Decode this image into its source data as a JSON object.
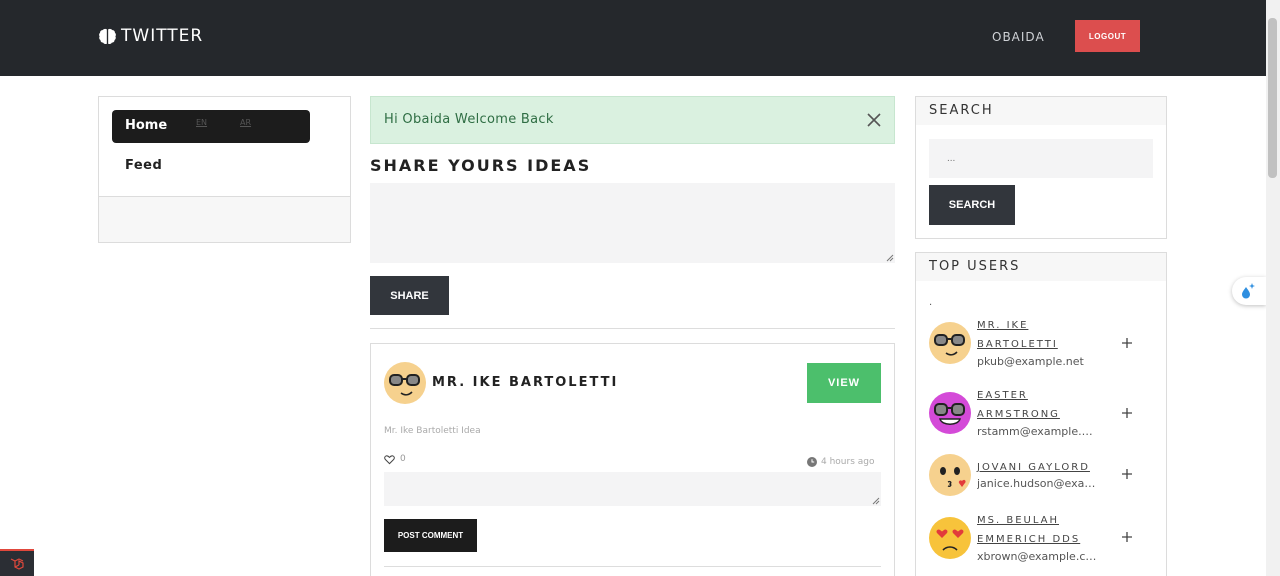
{
  "navbar": {
    "brand": "TWITTER",
    "user": "OBAIDA",
    "logout_label": "LOGOUT"
  },
  "sidebar": {
    "items": [
      {
        "label": "Home",
        "active": true
      },
      {
        "label": "Feed",
        "active": false
      }
    ],
    "languages": [
      "EN",
      "AR"
    ]
  },
  "alert": {
    "message": "Hi Obaida Welcome Back"
  },
  "share": {
    "title": "SHARE YOURS IDEAS",
    "button_label": "SHARE"
  },
  "post": {
    "author": "MR. IKE BARTOLETTI",
    "view_label": "VIEW",
    "idea_text": "Mr. Ike Bartoletti Idea",
    "likes": "0",
    "time": "4 hours ago",
    "comment_button_label": "POST COMMENT"
  },
  "search": {
    "title": "SEARCH",
    "placeholder": "...",
    "button_label": "SEARCH"
  },
  "top_users": {
    "title": "TOP USERS",
    "marker": ".",
    "users": [
      {
        "name": "MR. IKE BARTOLETTI",
        "email": "pkub@example.net",
        "avatar": "nerd-face-icon"
      },
      {
        "name": "EASTER ARMSTRONG",
        "email": "rstamm@example.org",
        "avatar": "nerd-face-purple-icon"
      },
      {
        "name": "JOVANI GAYLORD",
        "email": "janice.hudson@example.com",
        "avatar": "kissing-face-icon"
      },
      {
        "name": "MS. BEULAH EMMERICH DDS",
        "email": "xbrown@example.com",
        "avatar": "heart-eyes-face-icon"
      }
    ]
  },
  "colors": {
    "navbar": "#25282c",
    "logout": "#dc4e4e",
    "view": "#4cbf6c",
    "alert_bg": "#daf1e0",
    "dark_button": "#32363c"
  }
}
